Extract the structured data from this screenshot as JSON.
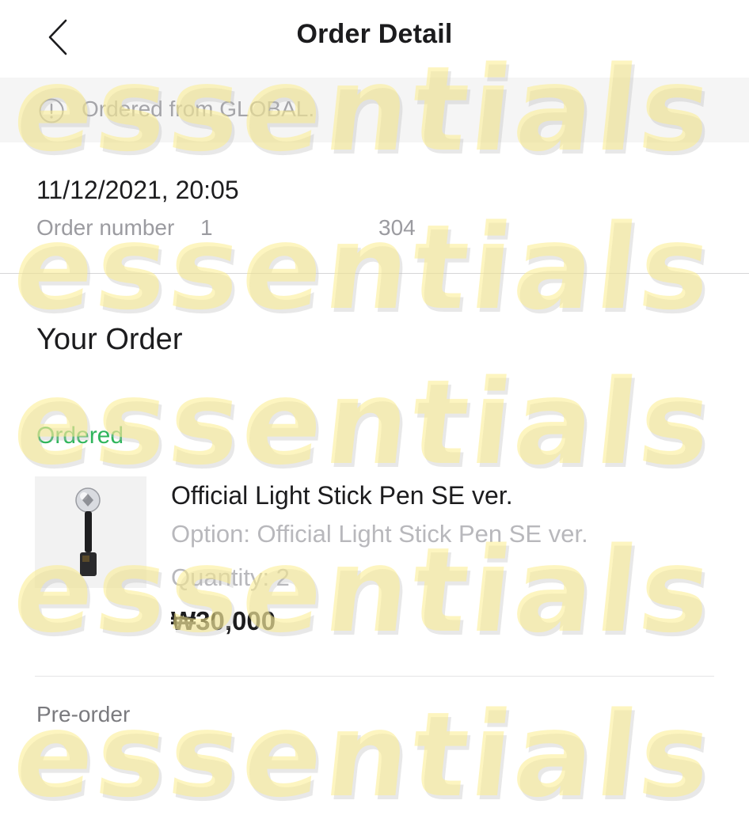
{
  "header": {
    "title": "Order Detail",
    "back_icon": "chevron-left-icon"
  },
  "notice": {
    "icon": "info-circle-icon",
    "text": "Ordered from GLOBAL."
  },
  "order": {
    "date": "11/12/2021, 20:05",
    "number_label": "Order number",
    "number_visible_start": "1",
    "number_visible_end": "304"
  },
  "section": {
    "title": "Your Order"
  },
  "item": {
    "status": "Ordered",
    "status_color": "#2fb55b",
    "name": "Official Light Stick Pen SE ver.",
    "option": "Option: Official Light Stick Pen SE ver.",
    "quantity": "Quantity: 2",
    "price": "₩30,000"
  },
  "footer": {
    "label": "Pre-order"
  },
  "watermark": {
    "text": "essentials se"
  }
}
